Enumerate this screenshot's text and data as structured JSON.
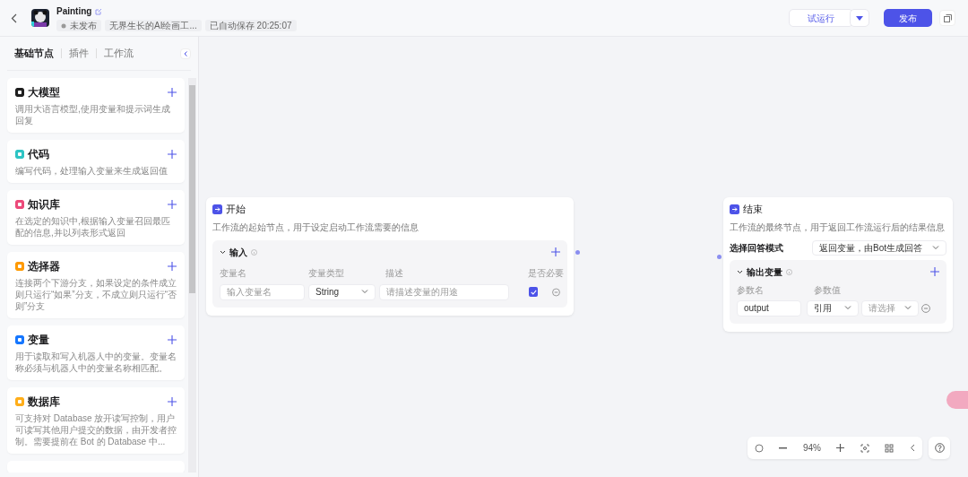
{
  "header": {
    "title": "Painting",
    "status": "未发布",
    "description": "无界生长的AI绘画工...",
    "autosave": "已自动保存 20:25:07",
    "run_button": "试运行",
    "publish_button": "发布"
  },
  "sidebar": {
    "tabs": [
      {
        "label": "基础节点",
        "selected": true
      },
      {
        "label": "插件",
        "selected": false
      },
      {
        "label": "工作流",
        "selected": false
      }
    ],
    "items": [
      {
        "title": "大模型",
        "description": "调用大语言模型,使用变量和提示词生成回复",
        "color": "#1f1f1f"
      },
      {
        "title": "代码",
        "description": "编写代码，处理输入变量来生成返回值",
        "color": "#2ec4c4"
      },
      {
        "title": "知识库",
        "description": "在选定的知识中,根据输入变量召回最匹配的信息,并以列表形式返回",
        "color": "#ec4a7a"
      },
      {
        "title": "选择器",
        "description": "连接两个下游分支，如果设定的条件成立则只运行“如果”分支，不成立则只运行“否则”分支",
        "color": "#ff9a00"
      },
      {
        "title": "变量",
        "description": "用于读取和写入机器人中的变量。变量名称必须与机器人中的变量名称相匹配。",
        "color": "#1677ff"
      },
      {
        "title": "数据库",
        "description": "可支持对 Database 放开读写控制，用户可读写其他用户提交的数据，由开发者控制。需要提前在 Bot 的 Database 中...",
        "color": "#ffae1a"
      }
    ]
  },
  "start_node": {
    "title": "开始",
    "description": "工作流的起始节点，用于设定启动工作流需要的信息",
    "section": {
      "title": "输入",
      "expanded": true,
      "columns": [
        "变量名",
        "变量类型",
        "描述",
        "是否必要"
      ],
      "rows": [
        {
          "name": {
            "placeholder": "输入变量名"
          },
          "type": "String",
          "description": {
            "placeholder": "请描述变量的用途"
          },
          "required": true
        }
      ]
    }
  },
  "end_node": {
    "title": "结束",
    "description": "工作流的最终节点，用于返回工作流运行后的结果信息",
    "mode_label": "选择回答模式",
    "mode": "返回变量，由Bot生成回答",
    "section": {
      "title": "输出变量",
      "expanded": true,
      "columns": [
        "参数名",
        "参数值"
      ],
      "rows": [
        {
          "name": "output",
          "source": "引用",
          "value": {
            "placeholder": "请选择"
          }
        }
      ]
    }
  },
  "zoom_toolbar": {
    "zoom": "94%"
  }
}
